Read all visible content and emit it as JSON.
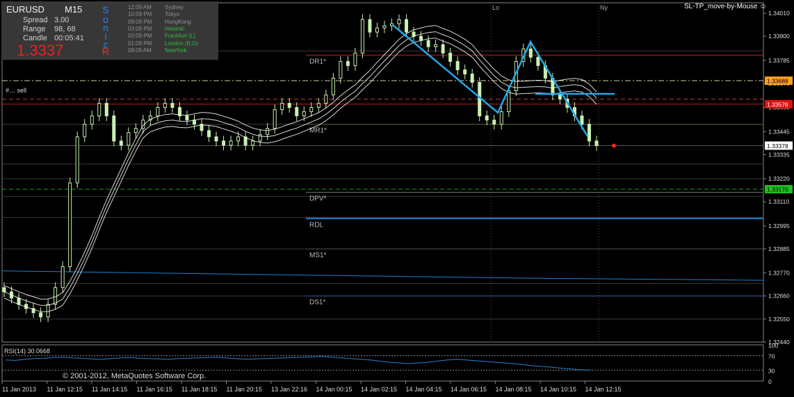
{
  "header": {
    "symbol": "EURUSD",
    "timeframe": "M15",
    "spread_label": "Spread",
    "spread_value": "3.00",
    "range_label": "Range",
    "range_value": "98, 68",
    "candle_label": "Candle",
    "candle_value": "00:05:41",
    "price": "1.3337",
    "sonic_letters": [
      "S",
      "o",
      "n",
      "i",
      "c",
      "R"
    ],
    "sessions": [
      {
        "time": "12:09 AM",
        "name": "Sydney",
        "active": false
      },
      {
        "time": "10:09 PM",
        "name": "Tokyo",
        "active": false
      },
      {
        "time": "09:09 PM",
        "name": "HongKong",
        "active": false
      },
      {
        "time": "03:09 PM",
        "name": "Helsinki",
        "active": true
      },
      {
        "time": "02:09 PM",
        "name": "Frankfurt (L)",
        "active": true
      },
      {
        "time": "01:09 PM",
        "name": "London (B,G)",
        "active": true
      },
      {
        "time": "08:09 AM",
        "name": "NewYork",
        "active": true
      }
    ],
    "ea_label": "SL-TP_move-by-Mouse",
    "sell_label": "#… sell",
    "copyright": "© 2001-2012, MetaQuotes Software Corp."
  },
  "colors": {
    "candle": "#c8f0b0",
    "ma": "#ffffff",
    "pattern": "#22a8e8",
    "grid": "#5a5a5a",
    "price_up": "#ff2020",
    "label_orange": "#ffb040",
    "label_red": "#ff2020",
    "label_green": "#20c020",
    "rsi": "#2a7fd0"
  },
  "chart_data": {
    "type": "candlestick",
    "price_axis": {
      "ticks": [
        "1.34010",
        "1.33900",
        "1.33785",
        "1.33675",
        "1.33560",
        "1.33445",
        "1.33335",
        "1.33220",
        "1.33110",
        "1.32995",
        "1.32885",
        "1.32770",
        "1.32660",
        "1.32550",
        "1.32440"
      ],
      "ylim": [
        1.3244,
        1.3406
      ]
    },
    "time_axis": {
      "labels": [
        "11 Jan 2013",
        "11 Jan 12:15",
        "11 Jan 14:15",
        "11 Jan 16:15",
        "11 Jan 18:15",
        "11 Jan 20:15",
        "13 Jan 22:16",
        "14 Jan 00:15",
        "14 Jan 02:15",
        "14 Jan 04:15",
        "14 Jan 06:15",
        "14 Jan 08:15",
        "14 Jan 10:15",
        "14 Jan 12:15"
      ]
    },
    "session_markers": [
      "Lo",
      "Ny"
    ],
    "current_price": "1.33378",
    "price_labels": [
      {
        "text": "1.33688",
        "style": "orange",
        "value": 1.33688
      },
      {
        "text": "1.33576",
        "style": "red",
        "value": 1.33576
      },
      {
        "text": "1.33378",
        "style": "white",
        "value": 1.33378
      },
      {
        "text": "1.33170",
        "style": "green",
        "value": 1.3317
      }
    ],
    "pivot_levels": [
      {
        "name": "DR1*",
        "value": 1.3381
      },
      {
        "name": "MR1*",
        "value": 1.3348
      },
      {
        "name": "DPV*",
        "value": 1.33155
      },
      {
        "name": "RDL",
        "value": 1.3303
      },
      {
        "name": "MS1*",
        "value": 1.32885
      },
      {
        "name": "DS1*",
        "value": 1.3266
      }
    ],
    "rsi": {
      "label": "RSI(14) 30.0668",
      "period": 14,
      "value": 30.0668,
      "levels": [
        70,
        30
      ],
      "axis_ticks": [
        "100",
        "70",
        "30",
        "0"
      ],
      "series": [
        58,
        57,
        60,
        62,
        63,
        65,
        66,
        64,
        63,
        61,
        60,
        62,
        64,
        65,
        63,
        62,
        61,
        60,
        62,
        63,
        64,
        65,
        66,
        64,
        62,
        60,
        61,
        62,
        63,
        64,
        65,
        66,
        67,
        68,
        66,
        64,
        62,
        60,
        58,
        55,
        52,
        50,
        48,
        50,
        52,
        55,
        58,
        60,
        58,
        56,
        54,
        52,
        50,
        48,
        45,
        42,
        40,
        38,
        35,
        33,
        31,
        30
      ]
    }
  }
}
